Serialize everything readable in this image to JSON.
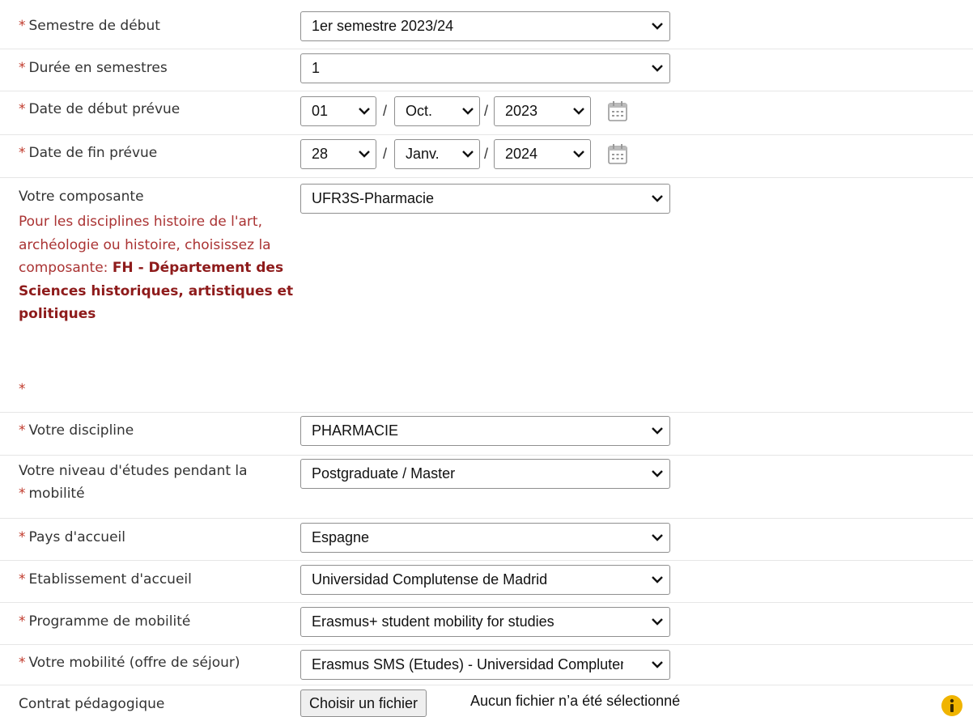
{
  "required_marker": "*",
  "fields": {
    "semestre_debut": {
      "label": "Semestre de début",
      "value": "1er semestre 2023/24"
    },
    "duree": {
      "label": "Durée en semestres",
      "value": "1"
    },
    "date_debut": {
      "label": "Date de début prévue",
      "day": "01",
      "month": "Oct.",
      "year": "2023"
    },
    "date_fin": {
      "label": "Date de fin prévue",
      "day": "28",
      "month": "Janv.",
      "year": "2024"
    },
    "composante": {
      "label": "Votre composante",
      "value": "UFR3S-Pharmacie",
      "note_plain": "Pour les disciplines histoire de l'art, archéologie ou histoire, choisissez la composante:",
      "note_bold": "FH - Département des Sciences historiques, artistiques et politiques"
    },
    "discipline": {
      "label": "Votre discipline",
      "value": "PHARMACIE"
    },
    "niveau": {
      "label_line1": "Votre niveau d'études pendant la",
      "label_line2": "mobilité",
      "value": "Postgraduate / Master"
    },
    "pays": {
      "label": "Pays d'accueil",
      "value": "Espagne"
    },
    "etablissement": {
      "label": "Etablissement d'accueil",
      "value": "Universidad Complutense de Madrid"
    },
    "programme": {
      "label": "Programme de mobilité",
      "value": "Erasmus+ student mobility for studies"
    },
    "mobilite": {
      "label": "Votre mobilité (offre de séjour)",
      "value": "Erasmus SMS (Etudes) - Universidad Complutense de Madrid"
    },
    "contrat": {
      "label": "Contrat pédagogique",
      "button": "Choisir un fichier",
      "status": "Aucun fichier n’a été sélectionné"
    }
  },
  "colors": {
    "required": "#c0392b",
    "note": "#a33",
    "info_icon": "#f0b400"
  },
  "icons": {
    "select_arrow": "chevron-down-icon",
    "calendar": "calendar-icon",
    "info": "info-icon"
  }
}
